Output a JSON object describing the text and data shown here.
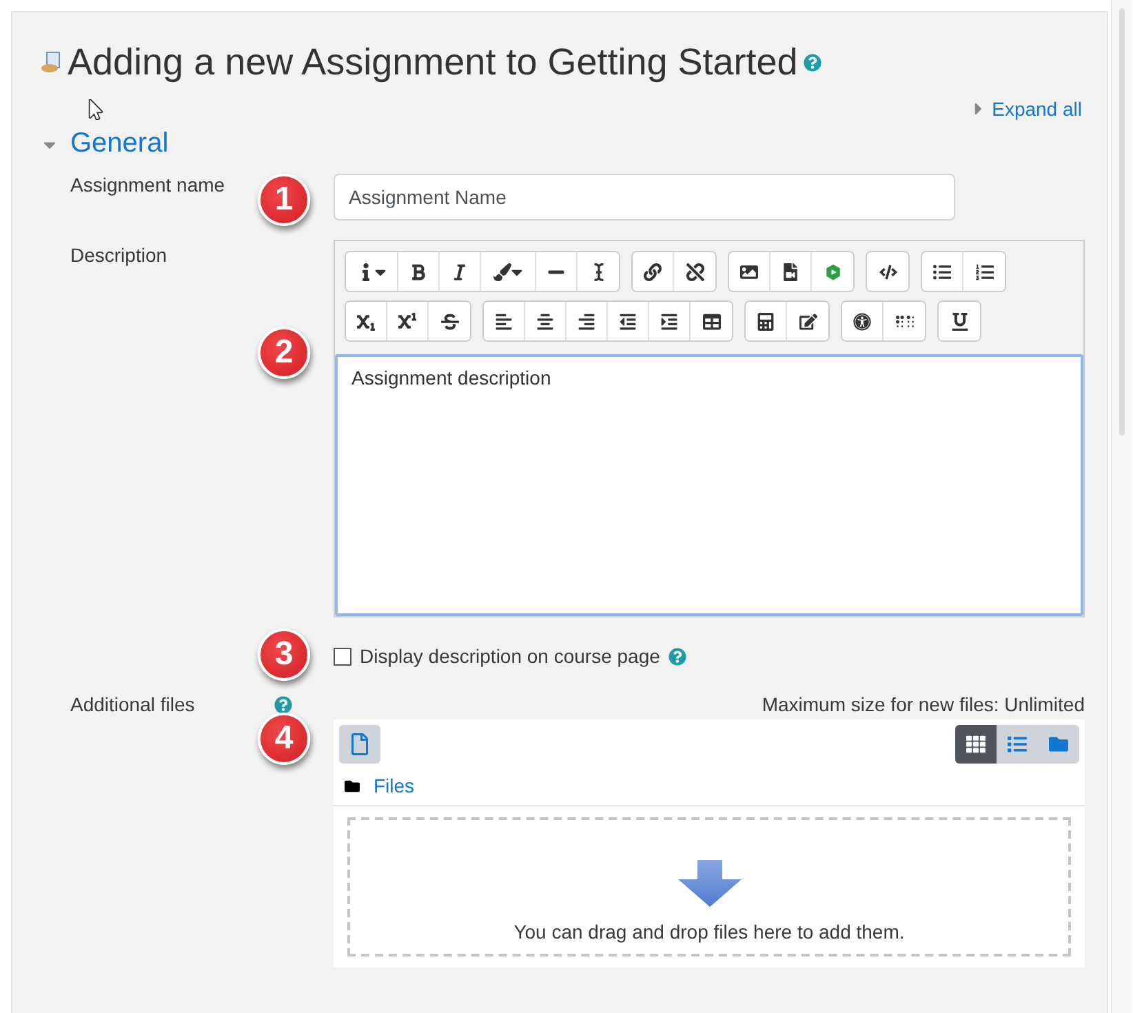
{
  "page": {
    "title": "Adding a new Assignment to Getting Started",
    "expand_all": "Expand all"
  },
  "section": {
    "title": "General",
    "expanded": true
  },
  "fields": [
    {
      "kind": "text",
      "label": "Assignment name",
      "badge": "1",
      "value": "Assignment Name"
    },
    {
      "kind": "editor",
      "label": "Description",
      "badge": "2",
      "value": "Assignment description"
    },
    {
      "kind": "checkbox",
      "badge": "3",
      "label": "Display description on course page",
      "checked": false
    },
    {
      "kind": "filemanager",
      "label": "Additional files",
      "badge": "4",
      "max_size": "Maximum size for new files: Unlimited",
      "folder": "Files",
      "drop_hint": "You can drag and drop files here to add them.",
      "view_modes": [
        {
          "kind": "grid",
          "selected": true
        },
        {
          "kind": "list",
          "selected": false
        },
        {
          "kind": "tree",
          "selected": false
        }
      ]
    }
  ]
}
